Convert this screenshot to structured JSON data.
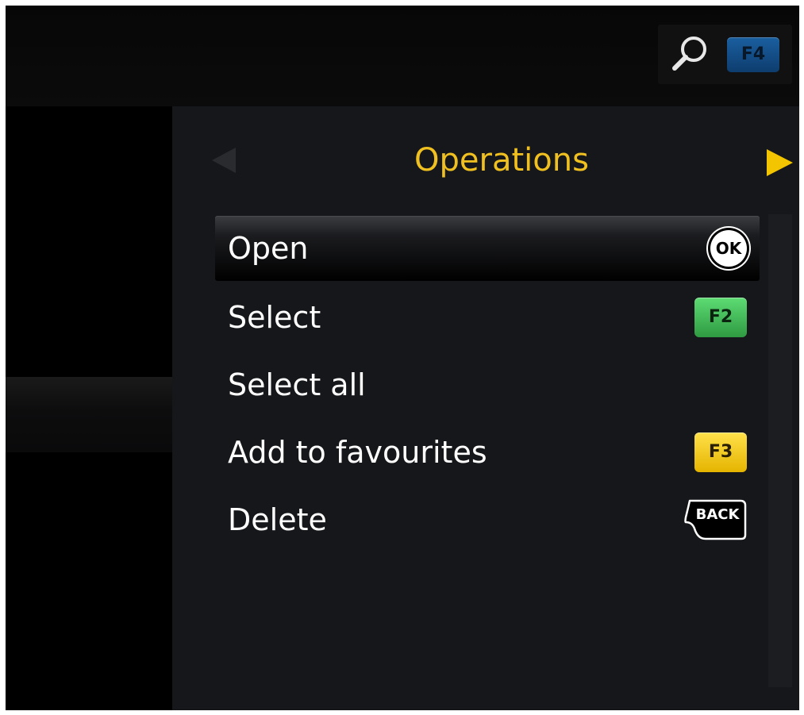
{
  "header": {
    "search_icon": "magnifier-icon",
    "search_key": "F4"
  },
  "panel": {
    "title": "Operations",
    "nav_prev_icon": "triangle-left-icon",
    "nav_next_icon": "triangle-right-icon"
  },
  "menu": {
    "selected_index": 0,
    "items": [
      {
        "label": "Open",
        "key": "OK",
        "key_color": "#ffffff"
      },
      {
        "label": "Select",
        "key": "F2",
        "key_color": "#3fbf57"
      },
      {
        "label": "Select all",
        "key": ""
      },
      {
        "label": "Add to favourites",
        "key": "F3",
        "key_color": "#f5cc10"
      },
      {
        "label": "Delete",
        "key": "BACK",
        "key_color": "#000000"
      }
    ]
  },
  "colors": {
    "accent_title": "#f0c020",
    "panel_bg": "#16171a",
    "f4_key": "#1a5fa0"
  }
}
